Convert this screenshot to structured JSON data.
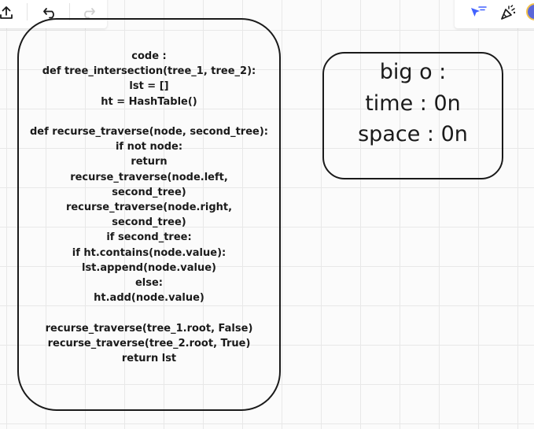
{
  "toolbar": {
    "left": {
      "icons": [
        "upload-icon",
        "undo-icon",
        "redo-icon"
      ],
      "redo_enabled": false
    },
    "right": {
      "icons": [
        "cursor-filter-icon",
        "celebrate-icon",
        "avatar"
      ]
    }
  },
  "code_card": {
    "lines": [
      "code :",
      "def tree_intersection(tree_1, tree_2):",
      "lst = []",
      "ht = HashTable()",
      "",
      "def recurse_traverse(node, second_tree):",
      "if not node:",
      "return",
      "recurse_traverse(node.left,",
      "second_tree)",
      "recurse_traverse(node.right,",
      "second_tree)",
      "if second_tree:",
      "if ht.contains(node.value):",
      "lst.append(node.value)",
      "else:",
      "ht.add(node.value)",
      "",
      "recurse_traverse(tree_1.root, False)",
      "recurse_traverse(tree_2.root, True)",
      "return lst"
    ]
  },
  "bigo_card": {
    "lines": [
      "big o :",
      "time : 0n",
      "space : 0n"
    ]
  },
  "colors": {
    "accent": "#4262ff",
    "ink": "#1a1a1a",
    "grid": "#e8e8e8",
    "avatar": "#5b67d8"
  }
}
